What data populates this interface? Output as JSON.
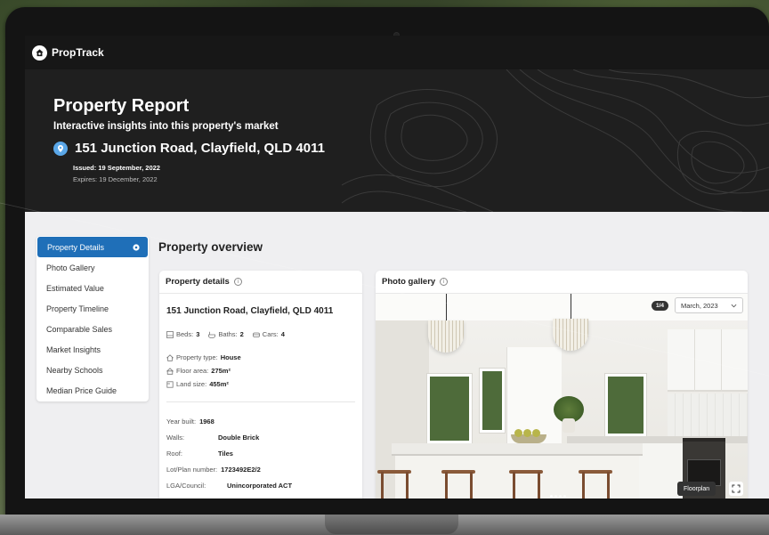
{
  "brand": {
    "name": "PropTrack"
  },
  "hero": {
    "title": "Property Report",
    "subtitle": "Interactive insights into this property's market",
    "address": "151 Junction Road, Clayfield, QLD 4011",
    "issued": "Issued: 19 September, 2022",
    "expires": "Expires: 19 December, 2022"
  },
  "sidebar": {
    "items": [
      {
        "label": "Property Details",
        "active": true
      },
      {
        "label": "Photo Gallery"
      },
      {
        "label": "Estimated Value"
      },
      {
        "label": "Property Timeline"
      },
      {
        "label": "Comparable Sales"
      },
      {
        "label": "Market Insights"
      },
      {
        "label": "Nearby Schools"
      },
      {
        "label": "Median Price Guide"
      }
    ]
  },
  "overview": {
    "title": "Property overview"
  },
  "details": {
    "header": "Property details",
    "address": "151 Junction Road, Clayfield, QLD 4011",
    "beds_label": "Beds:",
    "beds": "3",
    "baths_label": "Baths:",
    "baths": "2",
    "cars_label": "Cars:",
    "cars": "4",
    "type_label": "Property type:",
    "type": "House",
    "floor_label": "Floor area:",
    "floor": "275m²",
    "land_label": "Land size:",
    "land": "455m²",
    "year_label": "Year built:",
    "year": "1968",
    "walls_label": "Walls:",
    "walls": "Double Brick",
    "roof_label": "Roof:",
    "roof": "Tiles",
    "lot_label": "Lot/Plan number:",
    "lot": "1723492E2/2",
    "lga_label": "LGA/Council:",
    "lga": "Unincorporated ACT"
  },
  "gallery": {
    "header": "Photo gallery",
    "counter": "1/4",
    "date": "March, 2023",
    "floorplan": "Floorplan",
    "photo_index": 1,
    "photo_total": 4
  },
  "colors": {
    "accent": "#1f6fb8",
    "pin": "#5aa7e8",
    "dark": "#1f1f1f"
  },
  "icons": [
    "proptrack-logo-icon",
    "location-pin-icon",
    "gear-icon",
    "info-icon",
    "bed-icon",
    "bath-icon",
    "car-icon",
    "home-icon",
    "floor-area-icon",
    "land-size-icon",
    "chevron-down-icon",
    "expand-icon"
  ]
}
